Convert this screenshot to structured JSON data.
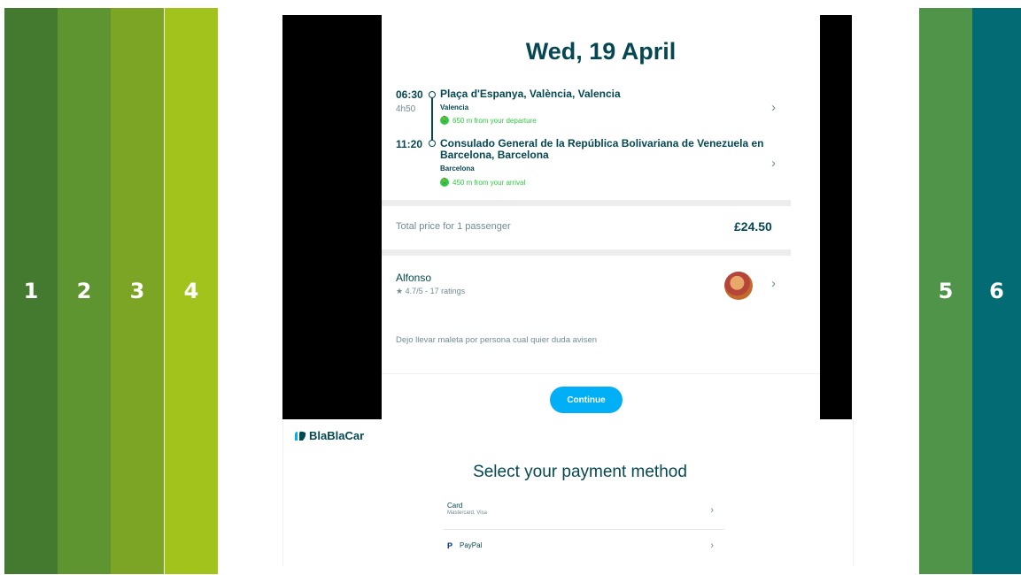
{
  "steps": [
    "1",
    "2",
    "3",
    "4",
    "5",
    "6"
  ],
  "trip": {
    "date": "Wed, 19 April",
    "departure_time": "06:30",
    "duration": "4h50",
    "departure_stop": "Plaça d'Espanya, València, Valencia",
    "departure_city": "Valencia",
    "departure_walk": "650 m from your departure",
    "arrival_time": "11:20",
    "arrival_stop_line1": "Consulado General de la República Bolivariana de Venezuela en",
    "arrival_stop_line2": "Barcelona, Barcelona",
    "arrival_city": "Barcelona",
    "arrival_walk": "450 m from your arrival",
    "price_label": "Total price for 1 passenger",
    "price": "£24.50",
    "driver_name": "Alfonso",
    "driver_rating": "★ 4.7/5 - 17 ratings",
    "driver_note": "Dejo llevar maleta por persona cual quier duda avisen",
    "continue_label": "Continue"
  },
  "payment": {
    "logo_text": "BlaBlaCar",
    "title": "Select your payment method",
    "card_label": "Card",
    "card_sub": "Mastercard, Visa",
    "paypal_label": "PayPal"
  },
  "colors": {
    "brand_dark": "#054752",
    "accent_blue": "#00aff5",
    "walk_green": "#2ecc40",
    "step_colors": [
      "#437a30",
      "#5e9530",
      "#7ca526",
      "#a2c31c",
      "#4f9449",
      "#036b74"
    ]
  },
  "icons": [
    "chevron-right-icon",
    "walking-icon",
    "star-icon",
    "blablacar-logo-icon",
    "paypal-icon"
  ]
}
